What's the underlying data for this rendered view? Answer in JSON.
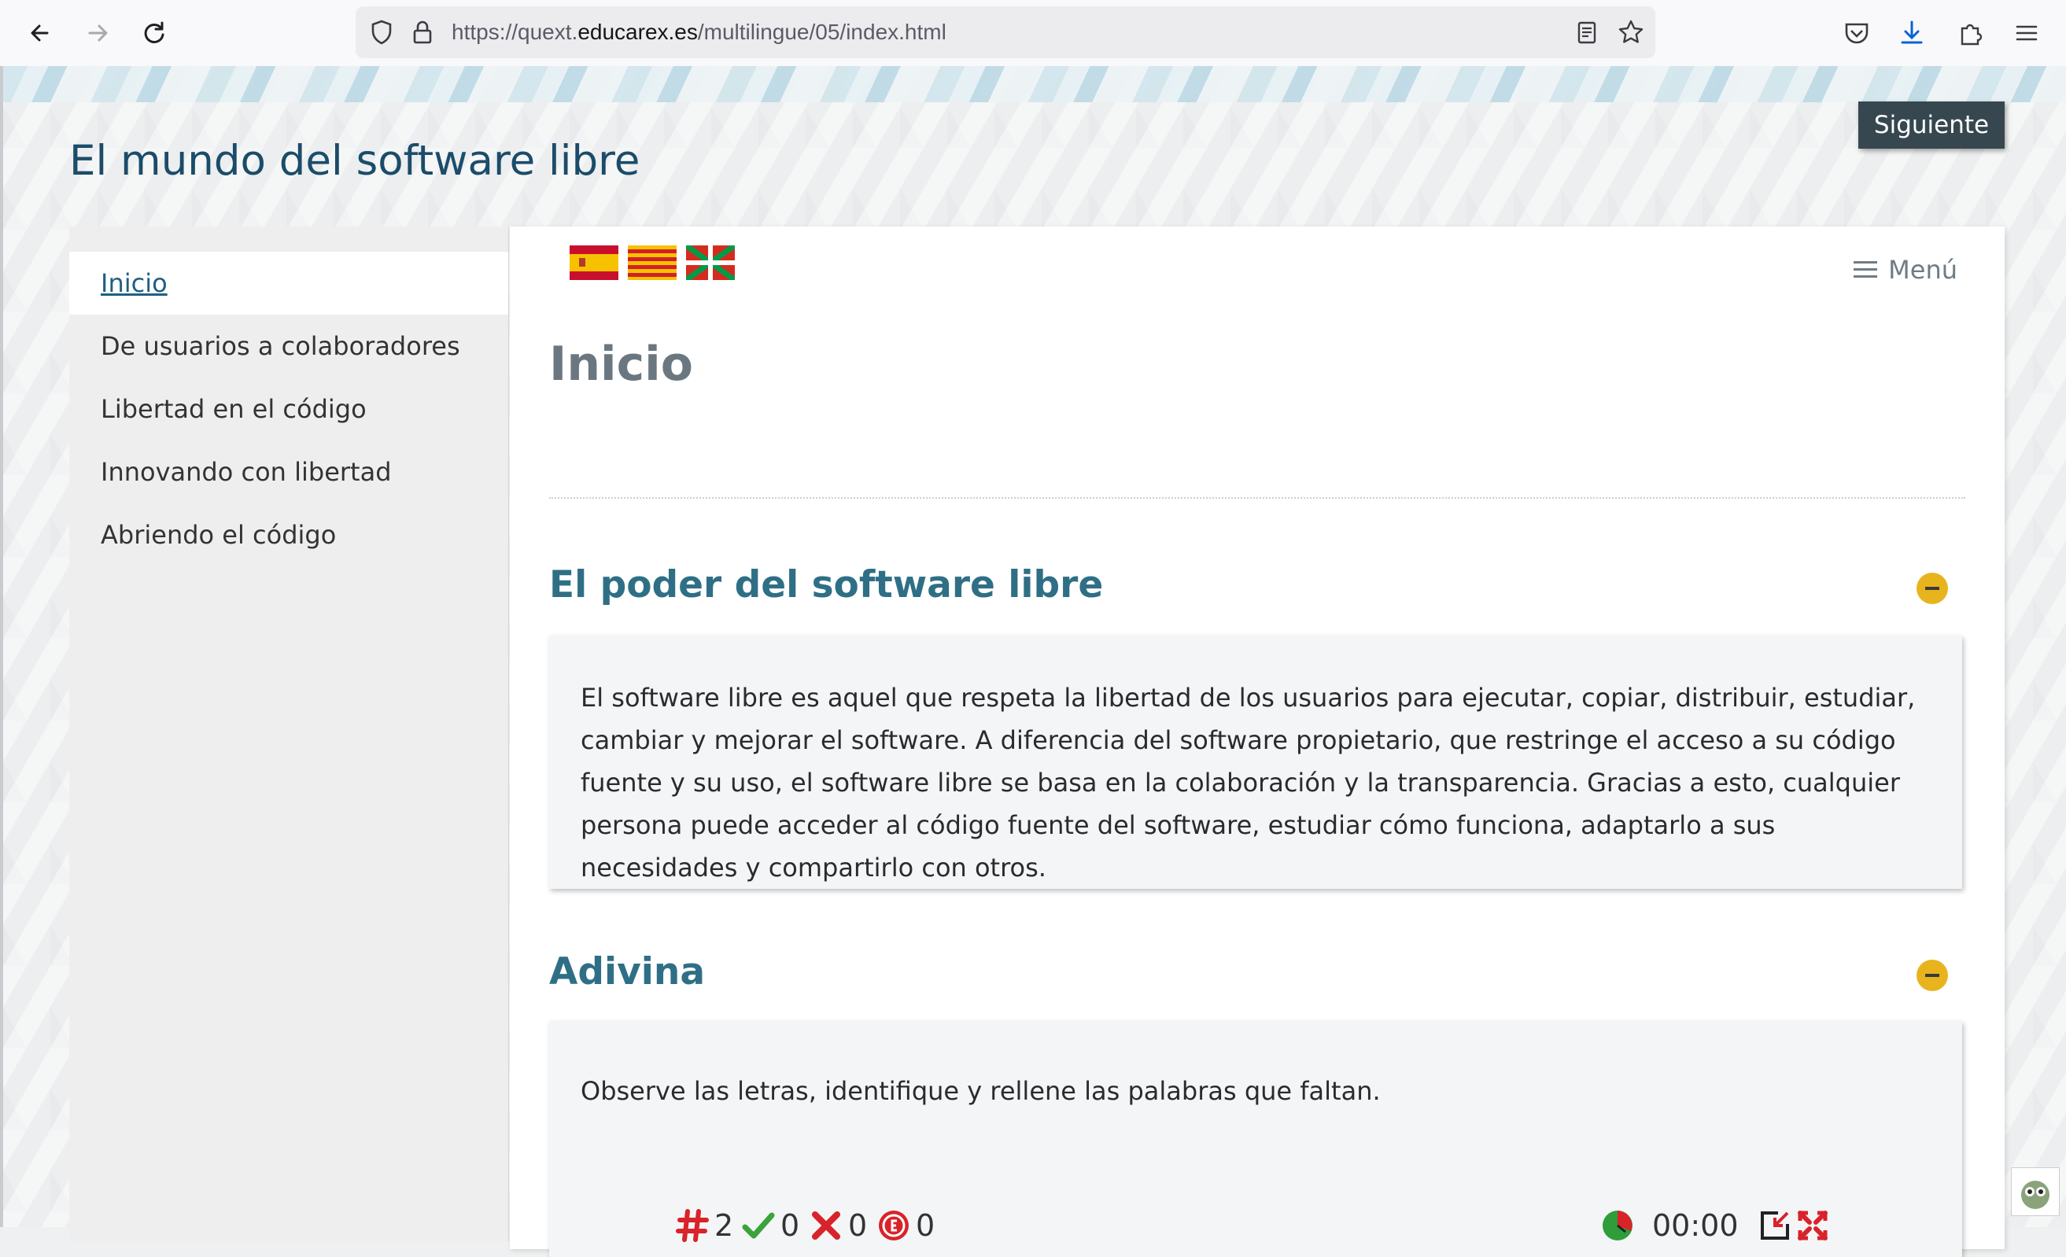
{
  "browser": {
    "url_prefix": "https://quext.",
    "url_domain": "educarex.es",
    "url_path": "/multilingue/05/index.html"
  },
  "site": {
    "title": "El mundo del software libre",
    "next_button": "Siguiente"
  },
  "sidebar": {
    "items": [
      {
        "label": "Inicio",
        "active": true
      },
      {
        "label": "De usuarios a colaboradores",
        "active": false
      },
      {
        "label": "Libertad en el código",
        "active": false
      },
      {
        "label": "Innovando con libertad",
        "active": false
      },
      {
        "label": "Abriendo el código",
        "active": false
      }
    ]
  },
  "content": {
    "languages": [
      "es",
      "ca",
      "eu"
    ],
    "menu_label": "Menú",
    "page_title": "Inicio",
    "sections": [
      {
        "title": "El poder del software libre",
        "text": "El software libre es aquel que respeta la libertad de los usuarios para ejecutar, copiar, distribuir, estudiar, cambiar y mejorar el software. A diferencia del software propietario, que restringe el acceso a su código fuente y su uso, el software libre se basa en la colaboración y la transparencia. Gracias a esto, cualquier persona puede acceder al código fuente del software, estudiar cómo funciona, adaptarlo a sus necesidades y compartirlo con otros."
      },
      {
        "title": "Adivina",
        "text": "Observe las letras, identifique y rellene las palabras que faltan."
      }
    ],
    "game": {
      "number": "2",
      "hits": "0",
      "errors": "0",
      "score": "0",
      "time": "00:00"
    }
  },
  "colors": {
    "title": "#1b4c6a",
    "section_title": "#2f6f86",
    "toggle": "#e8b41e",
    "next_button_bg": "#36474f"
  }
}
